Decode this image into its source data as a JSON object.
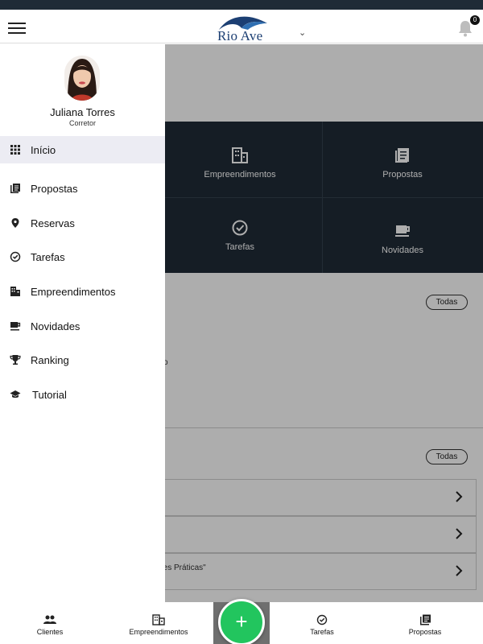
{
  "header": {
    "logo_text": "Rio Ave",
    "notification_count": "0"
  },
  "drawer": {
    "user_name": "Juliana Torres",
    "user_role": "Corretor",
    "items": [
      {
        "label": "Início",
        "icon": "grid-icon",
        "active": true
      },
      {
        "label": "Propostas",
        "icon": "document-icon"
      },
      {
        "label": "Reservas",
        "icon": "location-pin-icon"
      },
      {
        "label": "Tarefas",
        "icon": "check-circle-icon"
      },
      {
        "label": "Empreendimentos",
        "icon": "building-icon"
      },
      {
        "label": "Novidades",
        "icon": "coffee-cup-icon"
      },
      {
        "label": "Ranking",
        "icon": "trophy-icon"
      },
      {
        "label": "Tutorial",
        "icon": "graduation-cap-icon"
      }
    ]
  },
  "shortcuts": {
    "empreendimentos": "Empreendimentos",
    "propostas": "Propostas",
    "tarefas": "Tarefas",
    "novidades": "Novidades"
  },
  "sections": {
    "todas_1": "Todas",
    "todas_2": "Todas",
    "partial_1": "o",
    "row_1": "",
    "row_2": "nto",
    "row_3": "lhores Práticas\""
  },
  "bottom_nav": {
    "clientes": "Clientes",
    "empreendimentos": "Empreendimentos",
    "fab": "+",
    "tarefas": "Tarefas",
    "propostas": "Propostas"
  },
  "colors": {
    "dark_panel": "#1f2b37",
    "fab_green": "#22c55e",
    "logo_blue": "#1c3f73"
  }
}
